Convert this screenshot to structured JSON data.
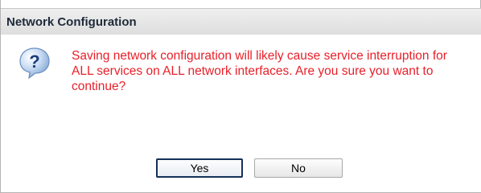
{
  "dialog": {
    "title": "Network Configuration",
    "icon": "question-icon",
    "message": "Saving network configuration will likely cause service interruption for ALL services on ALL network interfaces. Are you sure you want to continue?",
    "message_color": "#e8202a",
    "buttons": {
      "yes_label": "Yes",
      "no_label": "No"
    }
  }
}
